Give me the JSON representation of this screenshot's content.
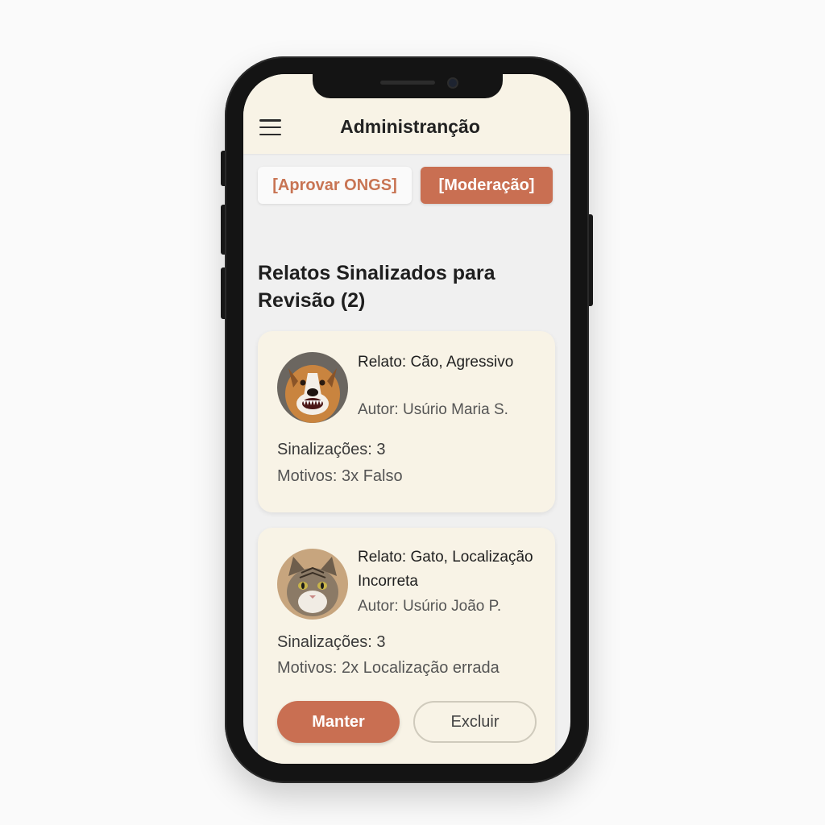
{
  "header": {
    "title": "Administranção",
    "menu_icon": "menu-icon"
  },
  "tabs": [
    {
      "label": "[Aprovar ONGS]",
      "active": false
    },
    {
      "label": "[Moderação]",
      "active": true
    }
  ],
  "section": {
    "title": "Relatos Sinalizados para Revisão (2)"
  },
  "reports": [
    {
      "title": "Relato: Cão, Agressivo",
      "author": "Autor: Usúrio Maria S.",
      "flags": "Sinalizações: 3",
      "reasons": "Motivos: 3x Falso",
      "avatar": "dog-photo"
    },
    {
      "title": "Relato: Gato, Localização Incorreta",
      "author": "Autor: Usúrio João P.",
      "flags": "Sinalizações: 3",
      "reasons": "Motivos: 2x Localização errada",
      "avatar": "cat-photo",
      "actions": {
        "keep_label": "Manter",
        "delete_label": "Excluir"
      }
    }
  ],
  "colors": {
    "accent": "#c96f52",
    "card_bg": "#f8f3e6",
    "screen_bg": "#f0f0f0"
  }
}
